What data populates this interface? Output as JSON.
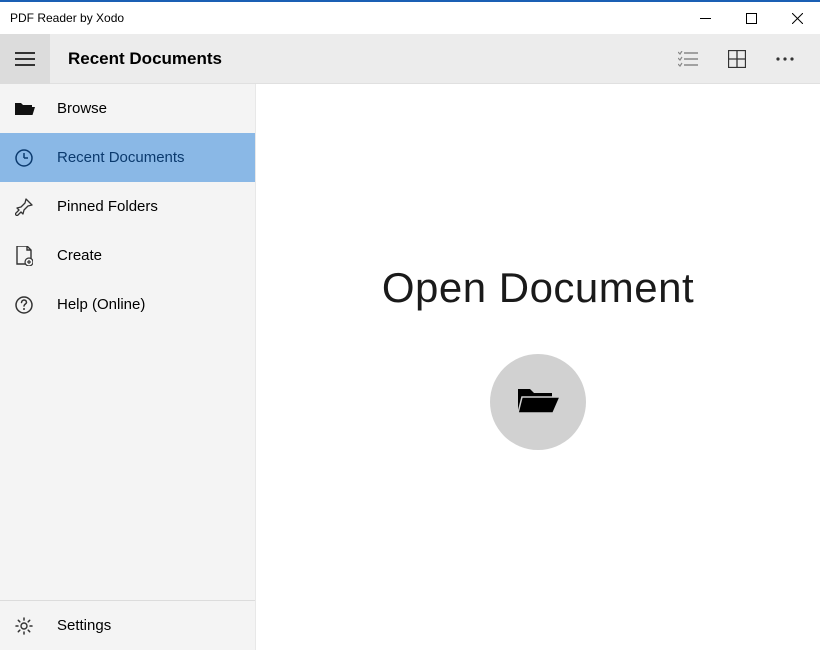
{
  "window": {
    "title": "PDF Reader by Xodo"
  },
  "toolbar": {
    "title": "Recent Documents"
  },
  "sidebar": {
    "items": [
      {
        "label": "Browse"
      },
      {
        "label": "Recent Documents"
      },
      {
        "label": "Pinned Folders"
      },
      {
        "label": "Create"
      },
      {
        "label": "Help (Online)"
      }
    ],
    "footer": {
      "label": "Settings"
    }
  },
  "main": {
    "heading": "Open Document"
  }
}
